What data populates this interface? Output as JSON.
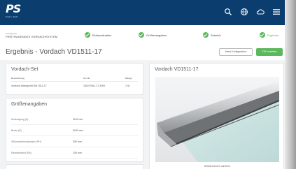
{
  "header": {
    "logo_text": "PS",
    "logo_tagline": "Profil + Stahl",
    "icons": [
      "search-icon",
      "globe-icon",
      "cloud-icon",
      "menu-icon"
    ]
  },
  "configurator": {
    "label": "Konfigurator",
    "name": "FREITRAGENDES VORDACHSYSTEM"
  },
  "steps": [
    {
      "label": "Einbausituation",
      "active": false
    },
    {
      "label": "Größenangaben",
      "active": false
    },
    {
      "label": "Zubehör",
      "active": false
    },
    {
      "label": "Ergebnis",
      "active": true
    }
  ],
  "page": {
    "title": "Ergebnis - Vordach VD1511-17",
    "new_config_button": "Neue Konfiguration",
    "pdf_button": "PDF erstellen"
  },
  "set": {
    "title": "Vordach-Set",
    "headers": [
      "Bezeichnung",
      "Art.-Nr.",
      "Menge"
    ],
    "row": [
      "Vordach-Wandprofil-Set 1511-17",
      "1511F0511-17-3000",
      "1 St."
    ]
  },
  "sizes": {
    "title": "Größenangaben",
    "rows": [
      {
        "label": "Auskragung (A)",
        "value": "1100 mm"
      },
      {
        "label": "Breite (B)",
        "value": "3000 mm"
      },
      {
        "label": "Stützscheibenabstand (RH)",
        "value": "300 mm"
      },
      {
        "label": "Randabstand (RA)",
        "value": "100 mm"
      }
    ]
  },
  "preview": {
    "title": "Vordach VD1511-17",
    "caption": "Details können variieren"
  },
  "colors": {
    "header_bg": "#0b3d6e",
    "accent_green": "#5cb85c",
    "page_bg": "#f2f3f5"
  }
}
